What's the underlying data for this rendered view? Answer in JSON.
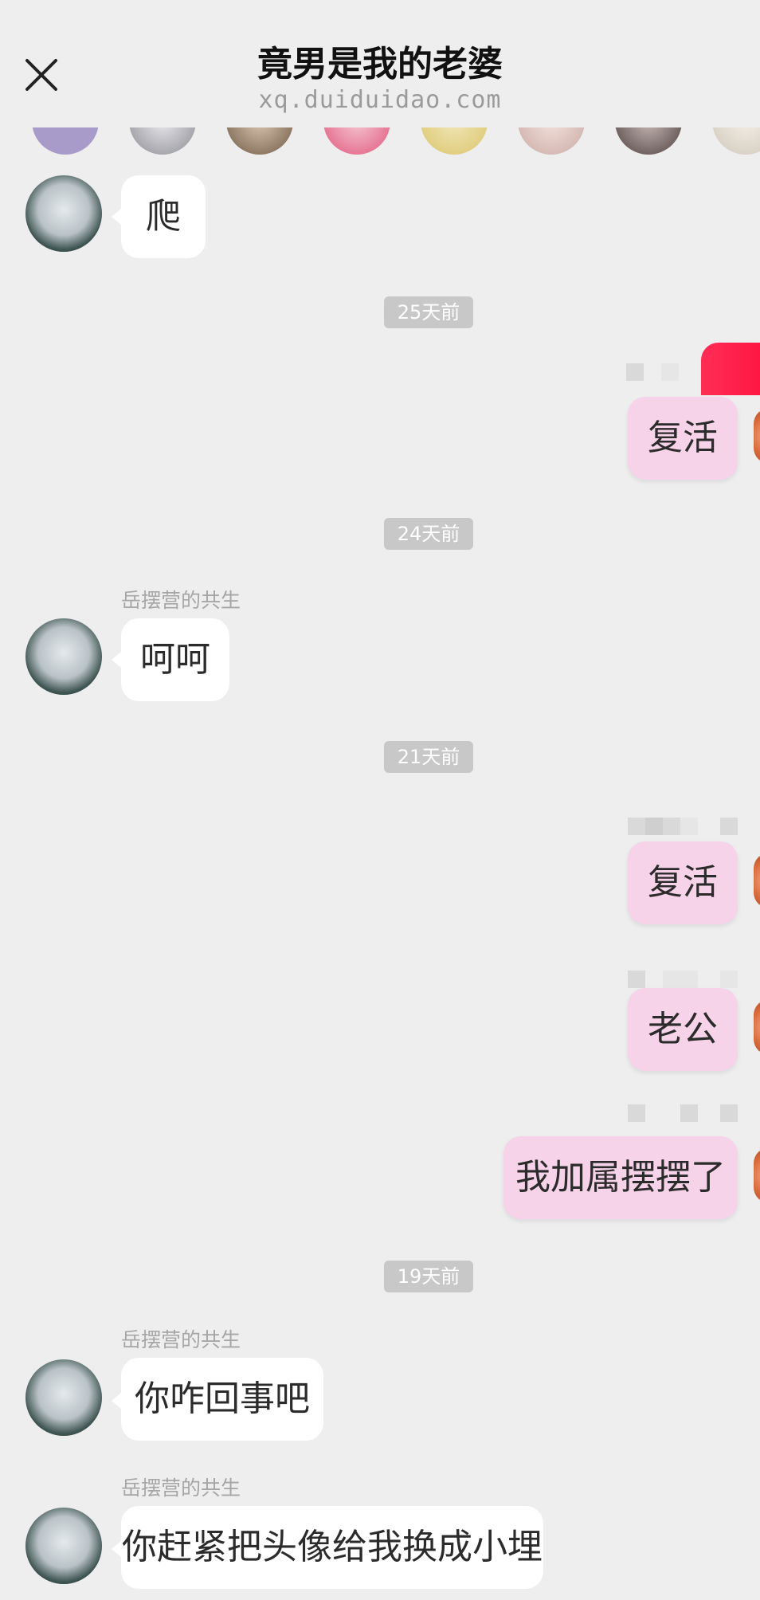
{
  "header": {
    "title": "竟男是我的老婆",
    "subtitle": "xq.duiduidao.com"
  },
  "timestamps": [
    "25天前",
    "24天前",
    "21天前",
    "19天前"
  ],
  "sender_name": "岳摆营的共生",
  "messages": {
    "left_1": "爬",
    "right_1": "复活",
    "left_2": "呵呵",
    "right_2": "复活",
    "right_3": "老公",
    "right_4": "我加属摆摆了",
    "left_3": "你咋回事吧",
    "left_4": "你赶紧把头像给我换成小埋"
  },
  "colors": {
    "background": "#eeeeee",
    "left_bubble": "#ffffff",
    "right_bubble": "#f6d3e8",
    "timestamp_pill": "#c8c8c8",
    "badge": "#ff2d55"
  },
  "icons": {
    "close": "close-icon"
  }
}
